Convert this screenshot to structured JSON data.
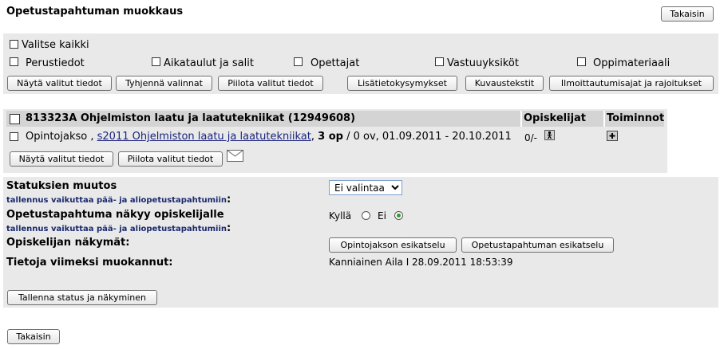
{
  "page": {
    "title": "Opetustapahtuman muokkaus",
    "back_label": "Takaisin"
  },
  "selection": {
    "select_all": "Valitse kaikki",
    "categories": [
      "Perustiedot",
      "Aikataulut ja salit",
      "Opettajat",
      "Vastuuyksiköt",
      "Oppimateriaali"
    ],
    "buttons": [
      "Näytä valitut tiedot",
      "Tyhjennä valinnat",
      "Piilota valitut tiedot",
      "Lisätietokysymykset",
      "Kuvaustekstit",
      "Ilmoittautumisajat ja rajoitukset"
    ]
  },
  "course": {
    "header": "813323A Ohjelmiston laatu ja laatutekniikat (12949608)",
    "col_students": "Opiskelijat",
    "col_actions": "Toiminnot",
    "row_type": "Opintojakso ,",
    "row_link": "s2011 Ohjelmiston laatu ja laatutekniikat",
    "row_sep": ",",
    "row_credits": "3 op",
    "row_rest": "/ 0 ov, 01.09.2011 - 20.10.2011",
    "students_count": "0/-",
    "show_btn": "Näytä valitut tiedot",
    "hide_btn": "Piilota valitut tiedot"
  },
  "status": {
    "change_label": "Statuksien muutos",
    "note": "tallennus vaikuttaa pää- ja aliopetustapahtumiin",
    "note_colon": ":",
    "select_value": "Ei valintaa",
    "visible_label": "Opetustapahtuma näkyy opiskelijalle",
    "yes": "Kyllä",
    "no": "Ei",
    "views_label": "Opiskelijan näkymät:",
    "preview_course": "Opintojakson esikatselu",
    "preview_event": "Opetustapahtuman esikatselu",
    "modified_label": "Tietoja viimeksi muokannut:",
    "modified_value": "Kanniainen Aila I 28.09.2011 18:53:39",
    "save_btn": "Tallenna status ja näkyminen"
  }
}
